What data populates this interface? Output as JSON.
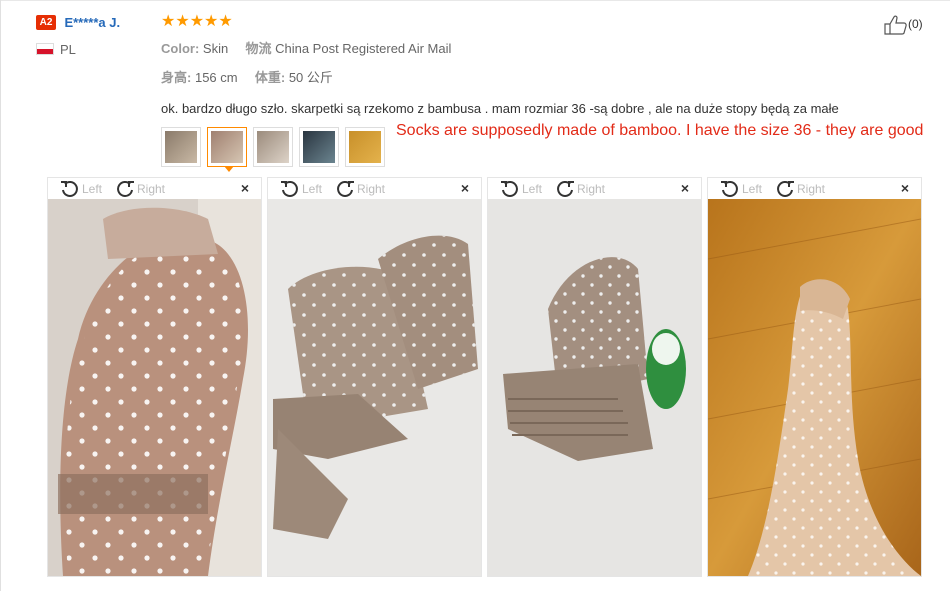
{
  "reviewer": {
    "badge": "A2",
    "name": "E*****a J.",
    "country": "PL"
  },
  "rating": {
    "stars": 5
  },
  "helpful": {
    "count": "(0)"
  },
  "meta": {
    "color_label": "Color:",
    "color_value": "Skin",
    "shipping_label": "物流",
    "shipping_value": "China Post Registered Air Mail",
    "height_label": "身高:",
    "height_value": "156 cm",
    "weight_label": "体重:",
    "weight_value": "50 公斤"
  },
  "comment": "ok. bardzo długo szło. skarpetki są rzekomo z bambusa . mam rozmiar 36 -są dobre , ale na duże stopy będą za małe",
  "translation": "Socks are supposedly made of bamboo. I have the size 36 - they are good",
  "thumbnails": [
    {
      "name": "hand-sock-thumb",
      "colors": [
        "#8a7a6a",
        "#c9b9a5"
      ]
    },
    {
      "name": "hand-sock-thumb-2",
      "colors": [
        "#a08070",
        "#d6c6b3"
      ],
      "active": true
    },
    {
      "name": "folded-socks-thumb",
      "colors": [
        "#9b8b7c",
        "#ddd3c8"
      ]
    },
    {
      "name": "bottle-thumb",
      "colors": [
        "#2a3540",
        "#6b8590"
      ]
    },
    {
      "name": "foot-floor-thumb",
      "colors": [
        "#c8902a",
        "#e4b24c"
      ]
    }
  ],
  "panels": [
    {
      "left_label": "Left",
      "right_label": "Right",
      "close": "×",
      "photo": "hand-in-sock-photo"
    },
    {
      "left_label": "Left",
      "right_label": "Right",
      "close": "×",
      "photo": "folded-socks-photo"
    },
    {
      "left_label": "Left",
      "right_label": "Right",
      "close": "×",
      "photo": "socks-and-bottle-photo"
    },
    {
      "left_label": "Left",
      "right_label": "Right",
      "close": "×",
      "photo": "foot-in-sock-photo"
    }
  ],
  "colors": {
    "star": "#ff9a00",
    "name": "#2569b9",
    "translation": "#e22b18",
    "active_border": "#ff8a00"
  }
}
